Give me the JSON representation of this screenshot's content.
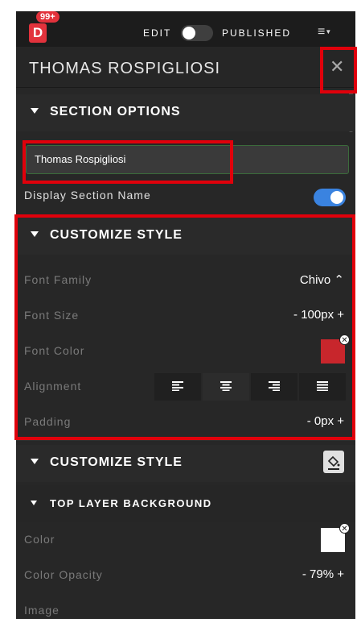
{
  "topbar": {
    "logo_letter": "D",
    "badge": "99+",
    "edit_label": "EDIT",
    "published_label": "PUBLISHED",
    "menu_icon": "hamburger-icon"
  },
  "panel": {
    "title": "THOMAS ROSPIGLIOSI",
    "close_icon": "close-icon"
  },
  "section_options": {
    "heading": "SECTION OPTIONS",
    "name_value": "Thomas Rospigliosi",
    "display_label": "Display Section Name",
    "display_enabled": true
  },
  "customize_style": {
    "heading": "CUSTOMIZE STYLE",
    "font_family_label": "Font Family",
    "font_family_value": "Chivo ⌃",
    "font_size_label": "Font Size",
    "font_size_value": "-  100px +",
    "font_color_label": "Font Color",
    "font_color": "#c8262c",
    "alignment_label": "Alignment",
    "alignment_options": [
      "left",
      "center",
      "right",
      "justify"
    ],
    "alignment_selected": "center",
    "padding_label": "Padding",
    "padding_value": "-    0px +"
  },
  "customize_style_2": {
    "heading": "CUSTOMIZE STYLE",
    "icon": "paint-bucket-icon"
  },
  "top_layer": {
    "heading": "TOP LAYER BACKGROUND",
    "color_label": "Color",
    "color": "#ffffff",
    "opacity_label": "Color Opacity",
    "opacity_value": "-  79% +",
    "image_label": "Image"
  },
  "colors": {
    "accent_red": "#e2323c",
    "toggle_blue": "#3a83e0",
    "highlight": "#e0000b"
  }
}
